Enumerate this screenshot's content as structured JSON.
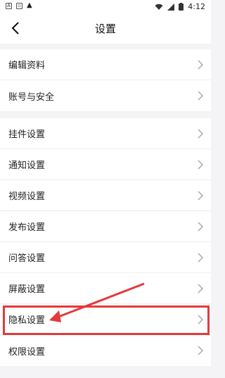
{
  "status_bar": {
    "left_icons": [
      "notification-a-icon",
      "android-icon",
      "warning-icon"
    ],
    "time": "4:12"
  },
  "header": {
    "title": "设置"
  },
  "sections": [
    {
      "items": [
        {
          "label": "编辑资料",
          "name": "edit-profile"
        },
        {
          "label": "账号与安全",
          "name": "account-security"
        }
      ]
    },
    {
      "items": [
        {
          "label": "挂件设置",
          "name": "pendant-settings"
        },
        {
          "label": "通知设置",
          "name": "notification-settings"
        },
        {
          "label": "视频设置",
          "name": "video-settings"
        },
        {
          "label": "发布设置",
          "name": "publish-settings"
        },
        {
          "label": "问答设置",
          "name": "qa-settings"
        },
        {
          "label": "屏蔽设置",
          "name": "block-settings"
        },
        {
          "label": "隐私设置",
          "name": "privacy-settings"
        },
        {
          "label": "权限设置",
          "name": "permission-settings"
        }
      ]
    }
  ],
  "annotation": {
    "highlight_color": "#e5393a"
  }
}
